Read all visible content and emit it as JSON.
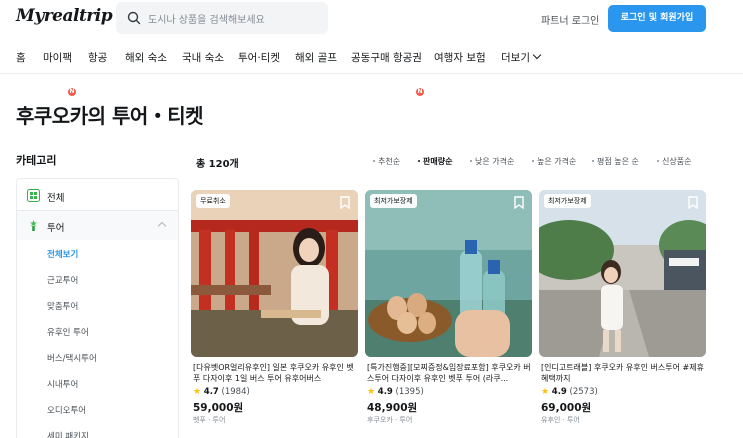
{
  "header": {
    "logo": "Myrealtrip",
    "search_placeholder": "도시나 상품을 검색해보세요",
    "partner_login": "파트너 로그인",
    "login_signup": "로그인 및 회원가입"
  },
  "nav": {
    "items": [
      {
        "label": "홈"
      },
      {
        "label": "마이팩",
        "badge": "N"
      },
      {
        "label": "항공"
      },
      {
        "label": "해외 숙소"
      },
      {
        "label": "국내 숙소"
      },
      {
        "label": "투어·티켓"
      },
      {
        "label": "해외 골프"
      },
      {
        "label": "공동구매 항공권",
        "badge": "N"
      },
      {
        "label": "여행자 보험"
      },
      {
        "label": "더보기"
      }
    ]
  },
  "page_title": "후쿠오카의 투어・티켓",
  "category": {
    "title": "카테고리",
    "all": "전체",
    "tour": "투어",
    "sub_items": [
      "전체보기",
      "근교투어",
      "맞춤투어",
      "유후인 투어",
      "버스/택시투어",
      "시내투어",
      "오디오투어",
      "세미 패키지"
    ]
  },
  "results": {
    "total": "총 120개",
    "sort_options": [
      "추천순",
      "판매량순",
      "낮은 가격순",
      "높은 가격순",
      "평점 높은 순",
      "신상품순"
    ],
    "active_sort": "판매량순"
  },
  "cards": [
    {
      "tag": "무료취소",
      "title": "[다유벳OR얼리유후인] 일본 후쿠오카 유후인 벳푸 다자이후 1일 버스 투어 유후어버스",
      "rating": "4.7",
      "reviews": "(1984)",
      "price": "59,000원",
      "location": "벳푸 · 투어"
    },
    {
      "tag": "최저가보장제",
      "title": "[특가진행중][모찌증정&입장료포함] 후쿠오카 버스투어 다자이후 유후인 벳푸 투어 (라쿠...",
      "rating": "4.9",
      "reviews": "(1395)",
      "price": "48,900원",
      "location": "후쿠오카 · 투어"
    },
    {
      "tag": "최저가보장제",
      "title": "[인디고트래블] 후쿠오카 유후인 버스투어 #제휴혜택까지",
      "rating": "4.9",
      "reviews": "(2573)",
      "price": "69,000원",
      "location": "유후인 · 투어"
    }
  ],
  "colors": {
    "accent": "#2b96ed",
    "badge": "#f55a4a",
    "star": "#ffc107"
  }
}
